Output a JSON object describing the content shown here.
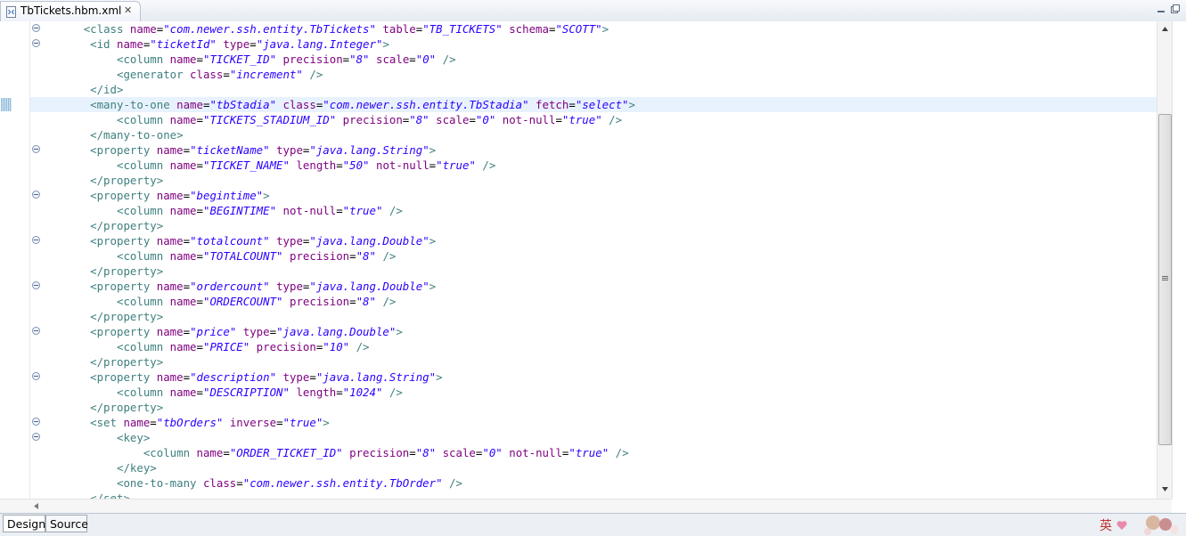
{
  "editor_tab": {
    "title": "TbTickets.hbm.xml",
    "close_symbol": "✕",
    "icon": "xml-file-icon"
  },
  "window_controls": {
    "minimize_icon": "minimize-icon",
    "maximize_icon": "maximize-icon"
  },
  "code_lines": [
    {
      "fold": true,
      "current": false,
      "tokens": [
        [
          "plain",
          "        "
        ],
        [
          "tag",
          "<class "
        ],
        [
          "attr",
          "name"
        ],
        [
          "plain",
          "="
        ],
        [
          "val",
          "\"com.newer.ssh.entity.TbTickets\""
        ],
        [
          "plain",
          " "
        ],
        [
          "attr",
          "table"
        ],
        [
          "plain",
          "="
        ],
        [
          "val",
          "\"TB_TICKETS\""
        ],
        [
          "plain",
          " "
        ],
        [
          "attr",
          "schema"
        ],
        [
          "plain",
          "="
        ],
        [
          "val",
          "\"SCOTT\""
        ],
        [
          "tag",
          ">"
        ]
      ]
    },
    {
      "fold": true,
      "current": false,
      "tokens": [
        [
          "plain",
          "         "
        ],
        [
          "tag",
          "<id "
        ],
        [
          "attr",
          "name"
        ],
        [
          "plain",
          "="
        ],
        [
          "val",
          "\"ticketId\""
        ],
        [
          "plain",
          " "
        ],
        [
          "attr",
          "type"
        ],
        [
          "plain",
          "="
        ],
        [
          "val",
          "\"java.lang.Integer\""
        ],
        [
          "tag",
          ">"
        ]
      ]
    },
    {
      "fold": false,
      "current": false,
      "tokens": [
        [
          "plain",
          "             "
        ],
        [
          "tag",
          "<column "
        ],
        [
          "attr",
          "name"
        ],
        [
          "plain",
          "="
        ],
        [
          "val",
          "\"TICKET_ID\""
        ],
        [
          "plain",
          " "
        ],
        [
          "attr",
          "precision"
        ],
        [
          "plain",
          "="
        ],
        [
          "val",
          "\"8\""
        ],
        [
          "plain",
          " "
        ],
        [
          "attr",
          "scale"
        ],
        [
          "plain",
          "="
        ],
        [
          "val",
          "\"0\""
        ],
        [
          "plain",
          " "
        ],
        [
          "tag",
          "/>"
        ]
      ]
    },
    {
      "fold": false,
      "current": false,
      "tokens": [
        [
          "plain",
          "             "
        ],
        [
          "tag",
          "<generator "
        ],
        [
          "attr",
          "class"
        ],
        [
          "plain",
          "="
        ],
        [
          "val",
          "\"increment\""
        ],
        [
          "plain",
          " "
        ],
        [
          "tag",
          "/>"
        ]
      ]
    },
    {
      "fold": false,
      "current": false,
      "tokens": [
        [
          "plain",
          "         "
        ],
        [
          "tag",
          "</id>"
        ]
      ]
    },
    {
      "fold": true,
      "current": true,
      "tokens": [
        [
          "plain",
          "         "
        ],
        [
          "tag",
          "<many-to-one "
        ],
        [
          "attr",
          "name"
        ],
        [
          "plain",
          "="
        ],
        [
          "val",
          "\"tbStadia\""
        ],
        [
          "plain",
          " "
        ],
        [
          "attr",
          "class"
        ],
        [
          "plain",
          "="
        ],
        [
          "val",
          "\"com.newer.ssh.entity.TbStadia\""
        ],
        [
          "plain",
          " "
        ],
        [
          "attr",
          "fetch"
        ],
        [
          "plain",
          "="
        ],
        [
          "val",
          "\"select\""
        ],
        [
          "tag",
          ">"
        ]
      ]
    },
    {
      "fold": false,
      "current": false,
      "tokens": [
        [
          "plain",
          "             "
        ],
        [
          "tag",
          "<column "
        ],
        [
          "attr",
          "name"
        ],
        [
          "plain",
          "="
        ],
        [
          "val",
          "\"TICKETS_STADIUM_ID\""
        ],
        [
          "plain",
          " "
        ],
        [
          "attr",
          "precision"
        ],
        [
          "plain",
          "="
        ],
        [
          "val",
          "\"8\""
        ],
        [
          "plain",
          " "
        ],
        [
          "attr",
          "scale"
        ],
        [
          "plain",
          "="
        ],
        [
          "val",
          "\"0\""
        ],
        [
          "plain",
          " "
        ],
        [
          "attr",
          "not-null"
        ],
        [
          "plain",
          "="
        ],
        [
          "val",
          "\"true\""
        ],
        [
          "plain",
          " "
        ],
        [
          "tag",
          "/>"
        ]
      ]
    },
    {
      "fold": false,
      "current": false,
      "tokens": [
        [
          "plain",
          "         "
        ],
        [
          "tag",
          "</many-to-one>"
        ]
      ]
    },
    {
      "fold": true,
      "current": false,
      "tokens": [
        [
          "plain",
          "         "
        ],
        [
          "tag",
          "<property "
        ],
        [
          "attr",
          "name"
        ],
        [
          "plain",
          "="
        ],
        [
          "val",
          "\"ticketName\""
        ],
        [
          "plain",
          " "
        ],
        [
          "attr",
          "type"
        ],
        [
          "plain",
          "="
        ],
        [
          "val",
          "\"java.lang.String\""
        ],
        [
          "tag",
          ">"
        ]
      ]
    },
    {
      "fold": false,
      "current": false,
      "tokens": [
        [
          "plain",
          "             "
        ],
        [
          "tag",
          "<column "
        ],
        [
          "attr",
          "name"
        ],
        [
          "plain",
          "="
        ],
        [
          "val",
          "\"TICKET_NAME\""
        ],
        [
          "plain",
          " "
        ],
        [
          "attr",
          "length"
        ],
        [
          "plain",
          "="
        ],
        [
          "val",
          "\"50\""
        ],
        [
          "plain",
          " "
        ],
        [
          "attr",
          "not-null"
        ],
        [
          "plain",
          "="
        ],
        [
          "val",
          "\"true\""
        ],
        [
          "plain",
          " "
        ],
        [
          "tag",
          "/>"
        ]
      ]
    },
    {
      "fold": false,
      "current": false,
      "tokens": [
        [
          "plain",
          "         "
        ],
        [
          "tag",
          "</property>"
        ]
      ]
    },
    {
      "fold": true,
      "current": false,
      "tokens": [
        [
          "plain",
          "         "
        ],
        [
          "tag",
          "<property "
        ],
        [
          "attr",
          "name"
        ],
        [
          "plain",
          "="
        ],
        [
          "val",
          "\"begintime\""
        ],
        [
          "tag",
          ">"
        ]
      ]
    },
    {
      "fold": false,
      "current": false,
      "tokens": [
        [
          "plain",
          "             "
        ],
        [
          "tag",
          "<column "
        ],
        [
          "attr",
          "name"
        ],
        [
          "plain",
          "="
        ],
        [
          "val",
          "\"BEGINTIME\""
        ],
        [
          "plain",
          " "
        ],
        [
          "attr",
          "not-null"
        ],
        [
          "plain",
          "="
        ],
        [
          "val",
          "\"true\""
        ],
        [
          "plain",
          " "
        ],
        [
          "tag",
          "/>"
        ]
      ]
    },
    {
      "fold": false,
      "current": false,
      "tokens": [
        [
          "plain",
          "         "
        ],
        [
          "tag",
          "</property>"
        ]
      ]
    },
    {
      "fold": true,
      "current": false,
      "tokens": [
        [
          "plain",
          "         "
        ],
        [
          "tag",
          "<property "
        ],
        [
          "attr",
          "name"
        ],
        [
          "plain",
          "="
        ],
        [
          "val",
          "\"totalcount\""
        ],
        [
          "plain",
          " "
        ],
        [
          "attr",
          "type"
        ],
        [
          "plain",
          "="
        ],
        [
          "val",
          "\"java.lang.Double\""
        ],
        [
          "tag",
          ">"
        ]
      ]
    },
    {
      "fold": false,
      "current": false,
      "tokens": [
        [
          "plain",
          "             "
        ],
        [
          "tag",
          "<column "
        ],
        [
          "attr",
          "name"
        ],
        [
          "plain",
          "="
        ],
        [
          "val",
          "\"TOTALCOUNT\""
        ],
        [
          "plain",
          " "
        ],
        [
          "attr",
          "precision"
        ],
        [
          "plain",
          "="
        ],
        [
          "val",
          "\"8\""
        ],
        [
          "plain",
          " "
        ],
        [
          "tag",
          "/>"
        ]
      ]
    },
    {
      "fold": false,
      "current": false,
      "tokens": [
        [
          "plain",
          "         "
        ],
        [
          "tag",
          "</property>"
        ]
      ]
    },
    {
      "fold": true,
      "current": false,
      "tokens": [
        [
          "plain",
          "         "
        ],
        [
          "tag",
          "<property "
        ],
        [
          "attr",
          "name"
        ],
        [
          "plain",
          "="
        ],
        [
          "val",
          "\"ordercount\""
        ],
        [
          "plain",
          " "
        ],
        [
          "attr",
          "type"
        ],
        [
          "plain",
          "="
        ],
        [
          "val",
          "\"java.lang.Double\""
        ],
        [
          "tag",
          ">"
        ]
      ]
    },
    {
      "fold": false,
      "current": false,
      "tokens": [
        [
          "plain",
          "             "
        ],
        [
          "tag",
          "<column "
        ],
        [
          "attr",
          "name"
        ],
        [
          "plain",
          "="
        ],
        [
          "val",
          "\"ORDERCOUNT\""
        ],
        [
          "plain",
          " "
        ],
        [
          "attr",
          "precision"
        ],
        [
          "plain",
          "="
        ],
        [
          "val",
          "\"8\""
        ],
        [
          "plain",
          " "
        ],
        [
          "tag",
          "/>"
        ]
      ]
    },
    {
      "fold": false,
      "current": false,
      "tokens": [
        [
          "plain",
          "         "
        ],
        [
          "tag",
          "</property>"
        ]
      ]
    },
    {
      "fold": true,
      "current": false,
      "tokens": [
        [
          "plain",
          "         "
        ],
        [
          "tag",
          "<property "
        ],
        [
          "attr",
          "name"
        ],
        [
          "plain",
          "="
        ],
        [
          "val",
          "\"price\""
        ],
        [
          "plain",
          " "
        ],
        [
          "attr",
          "type"
        ],
        [
          "plain",
          "="
        ],
        [
          "val",
          "\"java.lang.Double\""
        ],
        [
          "tag",
          ">"
        ]
      ]
    },
    {
      "fold": false,
      "current": false,
      "tokens": [
        [
          "plain",
          "             "
        ],
        [
          "tag",
          "<column "
        ],
        [
          "attr",
          "name"
        ],
        [
          "plain",
          "="
        ],
        [
          "val",
          "\"PRICE\""
        ],
        [
          "plain",
          " "
        ],
        [
          "attr",
          "precision"
        ],
        [
          "plain",
          "="
        ],
        [
          "val",
          "\"10\""
        ],
        [
          "plain",
          " "
        ],
        [
          "tag",
          "/>"
        ]
      ]
    },
    {
      "fold": false,
      "current": false,
      "tokens": [
        [
          "plain",
          "         "
        ],
        [
          "tag",
          "</property>"
        ]
      ]
    },
    {
      "fold": true,
      "current": false,
      "tokens": [
        [
          "plain",
          "         "
        ],
        [
          "tag",
          "<property "
        ],
        [
          "attr",
          "name"
        ],
        [
          "plain",
          "="
        ],
        [
          "val",
          "\"description\""
        ],
        [
          "plain",
          " "
        ],
        [
          "attr",
          "type"
        ],
        [
          "plain",
          "="
        ],
        [
          "val",
          "\"java.lang.String\""
        ],
        [
          "tag",
          ">"
        ]
      ]
    },
    {
      "fold": false,
      "current": false,
      "tokens": [
        [
          "plain",
          "             "
        ],
        [
          "tag",
          "<column "
        ],
        [
          "attr",
          "name"
        ],
        [
          "plain",
          "="
        ],
        [
          "val",
          "\"DESCRIPTION\""
        ],
        [
          "plain",
          " "
        ],
        [
          "attr",
          "length"
        ],
        [
          "plain",
          "="
        ],
        [
          "val",
          "\"1024\""
        ],
        [
          "plain",
          " "
        ],
        [
          "tag",
          "/>"
        ]
      ]
    },
    {
      "fold": false,
      "current": false,
      "tokens": [
        [
          "plain",
          "         "
        ],
        [
          "tag",
          "</property>"
        ]
      ]
    },
    {
      "fold": true,
      "current": false,
      "tokens": [
        [
          "plain",
          "         "
        ],
        [
          "tag",
          "<set "
        ],
        [
          "attr",
          "name"
        ],
        [
          "plain",
          "="
        ],
        [
          "val",
          "\"tbOrders\""
        ],
        [
          "plain",
          " "
        ],
        [
          "attr",
          "inverse"
        ],
        [
          "plain",
          "="
        ],
        [
          "val",
          "\"true\""
        ],
        [
          "tag",
          ">"
        ]
      ]
    },
    {
      "fold": true,
      "current": false,
      "tokens": [
        [
          "plain",
          "             "
        ],
        [
          "tag",
          "<key>"
        ]
      ]
    },
    {
      "fold": false,
      "current": false,
      "tokens": [
        [
          "plain",
          "                 "
        ],
        [
          "tag",
          "<column "
        ],
        [
          "attr",
          "name"
        ],
        [
          "plain",
          "="
        ],
        [
          "val",
          "\"ORDER_TICKET_ID\""
        ],
        [
          "plain",
          " "
        ],
        [
          "attr",
          "precision"
        ],
        [
          "plain",
          "="
        ],
        [
          "val",
          "\"8\""
        ],
        [
          "plain",
          " "
        ],
        [
          "attr",
          "scale"
        ],
        [
          "plain",
          "="
        ],
        [
          "val",
          "\"0\""
        ],
        [
          "plain",
          " "
        ],
        [
          "attr",
          "not-null"
        ],
        [
          "plain",
          "="
        ],
        [
          "val",
          "\"true\""
        ],
        [
          "plain",
          " "
        ],
        [
          "tag",
          "/>"
        ]
      ]
    },
    {
      "fold": false,
      "current": false,
      "tokens": [
        [
          "plain",
          "             "
        ],
        [
          "tag",
          "</key>"
        ]
      ]
    },
    {
      "fold": false,
      "current": false,
      "tokens": [
        [
          "plain",
          "             "
        ],
        [
          "tag",
          "<one-to-many "
        ],
        [
          "attr",
          "class"
        ],
        [
          "plain",
          "="
        ],
        [
          "val",
          "\"com.newer.ssh.entity.TbOrder\""
        ],
        [
          "plain",
          " "
        ],
        [
          "tag",
          "/>"
        ]
      ]
    },
    {
      "fold": false,
      "current": false,
      "tokens": [
        [
          "plain",
          "         "
        ],
        [
          "tag",
          "</set>"
        ]
      ]
    }
  ],
  "bottom_tabs": {
    "design": "Design",
    "source": "Source"
  },
  "tray": {
    "ime_label": "英"
  },
  "colors": {
    "tag": "#3f7f7f",
    "attribute": "#7f007f",
    "value": "#2a00ff",
    "current_line": "#e8f2fe"
  }
}
